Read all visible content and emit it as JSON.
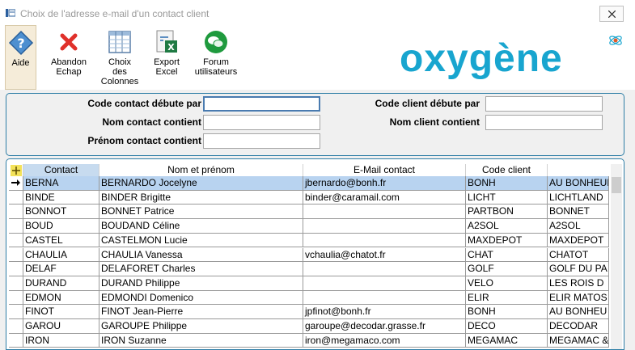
{
  "window": {
    "title": "Choix de l'adresse e-mail d'un contact client"
  },
  "toolbar": {
    "aide": "Aide",
    "abandon_l1": "Abandon",
    "abandon_l2": "Echap",
    "choix_l1": "Choix",
    "choix_l2": "des",
    "choix_l3": "Colonnes",
    "export_l1": "Export",
    "export_l2": "Excel",
    "forum_l1": "Forum",
    "forum_l2": "utilisateurs"
  },
  "logo": {
    "text": "oxygène"
  },
  "filters": {
    "code_contact_label": "Code contact débute par",
    "nom_contact_label": "Nom contact contient",
    "prenom_contact_label": "Prénom contact contient",
    "code_client_label": "Code client débute par",
    "nom_client_label": "Nom client contient",
    "code_contact_value": "",
    "nom_contact_value": "",
    "prenom_contact_value": "",
    "code_client_value": "",
    "nom_client_value": ""
  },
  "grid": {
    "columns": [
      "Contact",
      "Nom et prénom",
      "E-Mail contact",
      "Code client",
      ""
    ],
    "rows": [
      [
        "BERNA",
        "BERNARDO Jocelyne",
        "jbernardo@bonh.fr",
        "BONH",
        "AU BONHEUR"
      ],
      [
        "BINDE",
        "BINDER Brigitte",
        "binder@caramail.com",
        "LICHT",
        "LICHTLAND"
      ],
      [
        "BONNOT",
        "BONNET Patrice",
        "",
        "PARTBON",
        "BONNET"
      ],
      [
        "BOUD",
        "BOUDAND Céline",
        "",
        "A2SOL",
        "A2SOL"
      ],
      [
        "CASTEL",
        "CASTELMON Lucie",
        "",
        "MAXDEPOT",
        "MAXDEPOT"
      ],
      [
        "CHAULIA",
        "CHAULIA Vanessa",
        "vchaulia@chatot.fr",
        "CHAT",
        "CHATOT"
      ],
      [
        "DELAF",
        "DELAFORET Charles",
        "",
        "GOLF",
        "GOLF DU PA"
      ],
      [
        "DURAND",
        "DURAND Philippe",
        "",
        "VELO",
        "LES ROIS D"
      ],
      [
        "EDMON",
        "EDMONDI Domenico",
        "",
        "ELIR",
        "ELIR MATOS"
      ],
      [
        "FINOT",
        "FINOT Jean-Pierre",
        "jpfinot@bonh.fr",
        "BONH",
        "AU BONHEU"
      ],
      [
        "GAROU",
        "GAROUPE Philippe",
        "garoupe@decodar.grasse.fr",
        "DECO",
        "DECODAR"
      ],
      [
        "IRON",
        "IRON Suzanne",
        "iron@megamaco.com",
        "MEGAMAC",
        "MEGAMAC &"
      ]
    ]
  },
  "colors": {
    "accent": "#2e7ea6",
    "selection": "#b8d3f0",
    "logo": "#18a5cf"
  }
}
